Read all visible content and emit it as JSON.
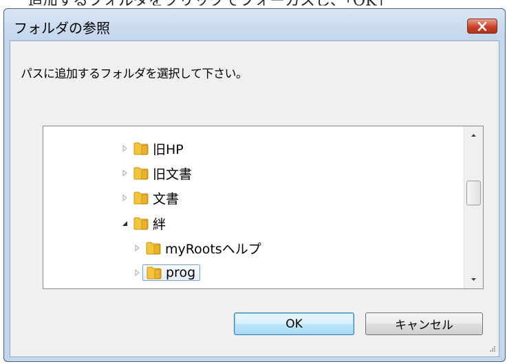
{
  "background": {
    "partial_text": "追加するフォルダをクリックでフォーカスし、「OK」"
  },
  "dialog": {
    "title": "フォルダの参照",
    "instruction": "パスに追加するフォルダを選択して下さい。",
    "tree": {
      "items": [
        {
          "label": "旧HP",
          "state": "collapsed",
          "level": 1,
          "selected": false
        },
        {
          "label": "旧文書",
          "state": "collapsed",
          "level": 1,
          "selected": false
        },
        {
          "label": "文書",
          "state": "collapsed",
          "level": 1,
          "selected": false
        },
        {
          "label": "絆",
          "state": "expanded",
          "level": 1,
          "selected": false
        },
        {
          "label": "myRootsヘルプ",
          "state": "collapsed",
          "level": 2,
          "selected": false
        },
        {
          "label": "prog",
          "state": "collapsed",
          "level": 2,
          "selected": true
        }
      ]
    },
    "buttons": {
      "ok": "OK",
      "cancel": "キャンセル"
    },
    "colors": {
      "titlebar": "#c2d5ec",
      "close_button": "#c9422c",
      "ok_button": "#bee6fd",
      "folder": "#e8b32f"
    }
  }
}
